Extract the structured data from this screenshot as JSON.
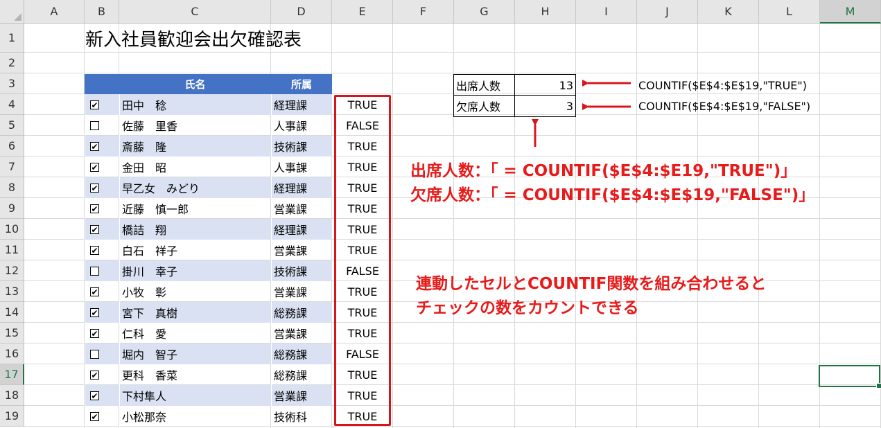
{
  "columns": [
    "A",
    "B",
    "C",
    "D",
    "E",
    "F",
    "G",
    "H",
    "I",
    "J",
    "K",
    "L",
    "M"
  ],
  "rows": [
    "1",
    "2",
    "3",
    "4",
    "5",
    "6",
    "7",
    "8",
    "9",
    "10",
    "11",
    "12",
    "13",
    "14",
    "15",
    "16",
    "17",
    "18",
    "19"
  ],
  "title": "新入社員歓迎会出欠確認表",
  "table_header": {
    "name": "氏名",
    "dept": "所属"
  },
  "employees": [
    {
      "checked": "✔",
      "name": "田中　稔",
      "dept": "経理課",
      "status": "TRUE"
    },
    {
      "checked": "",
      "name": "佐藤　里香",
      "dept": "人事課",
      "status": "FALSE"
    },
    {
      "checked": "✔",
      "name": "斎藤　隆",
      "dept": "技術課",
      "status": "TRUE"
    },
    {
      "checked": "✔",
      "name": "金田　昭",
      "dept": "人事課",
      "status": "TRUE"
    },
    {
      "checked": "✔",
      "name": "早乙女　みどり",
      "dept": "経理課",
      "status": "TRUE"
    },
    {
      "checked": "✔",
      "name": "近藤　慎一郎",
      "dept": "営業課",
      "status": "TRUE"
    },
    {
      "checked": "✔",
      "name": "橋詰　翔",
      "dept": "経理課",
      "status": "TRUE"
    },
    {
      "checked": "✔",
      "name": "白石　祥子",
      "dept": "営業課",
      "status": "TRUE"
    },
    {
      "checked": "",
      "name": "掛川　幸子",
      "dept": "技術課",
      "status": "FALSE"
    },
    {
      "checked": "✔",
      "name": "小牧　彰",
      "dept": "営業課",
      "status": "TRUE"
    },
    {
      "checked": "✔",
      "name": "宮下　真樹",
      "dept": "総務課",
      "status": "TRUE"
    },
    {
      "checked": "✔",
      "name": "仁科　愛",
      "dept": "営業課",
      "status": "TRUE"
    },
    {
      "checked": "",
      "name": "堀内　智子",
      "dept": "総務課",
      "status": "FALSE"
    },
    {
      "checked": "✔",
      "name": "更科　香菜",
      "dept": "総務課",
      "status": "TRUE"
    },
    {
      "checked": "✔",
      "name": "下村隼人",
      "dept": "営業課",
      "status": "TRUE"
    },
    {
      "checked": "✔",
      "name": "小松那奈",
      "dept": "技術科",
      "status": "TRUE"
    }
  ],
  "summary": {
    "attend_label": "出席人数",
    "attend_value": "13",
    "absent_label": "欠席人数",
    "absent_value": "3",
    "attend_formula": "COUNTIF($E$4:$E$19,\"TRUE\")",
    "absent_formula": "COUNTIF($E$4:$E$19,\"FALSE\")"
  },
  "annotations": {
    "line1": "出席人数：「 = COUNTIF($E$4:$E19,\"TRUE\")」",
    "line2": "欠席人数：「 = COUNTIF($E$4:$E$19,\"FALSE\")」",
    "note1": "連動したセルとCOUNTIF関数を組み合わせると",
    "note2": "チェックの数をカウントできる"
  },
  "colors": {
    "header_blue": "#4472c4",
    "band": "#d9e1f2",
    "annotation_red": "#e81a1a",
    "selection_green": "#217346"
  }
}
